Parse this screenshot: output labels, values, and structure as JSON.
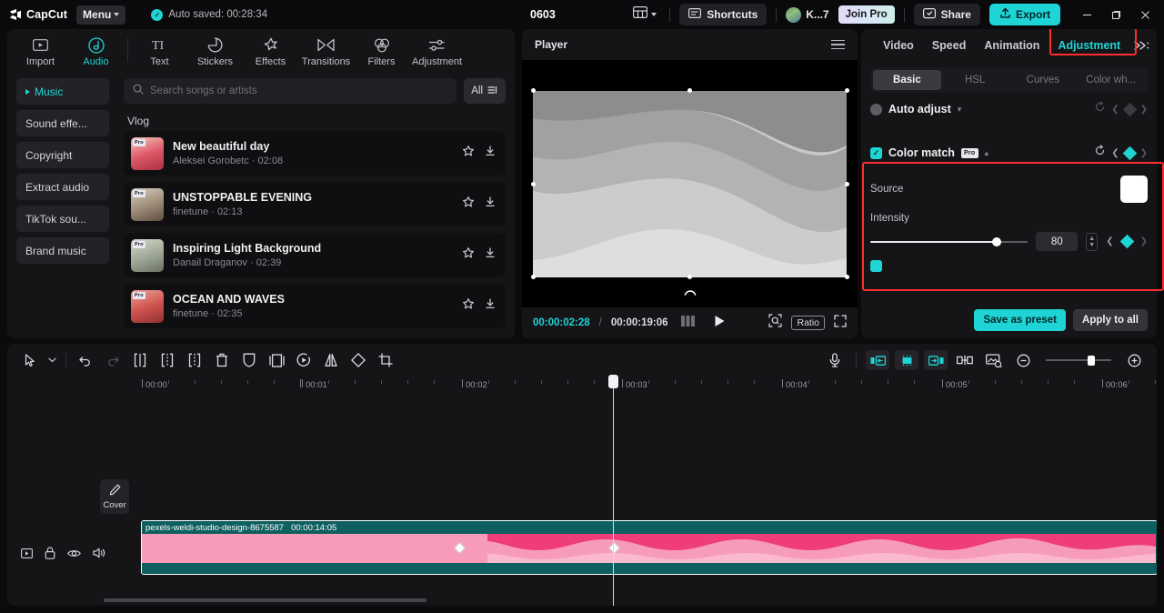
{
  "titlebar": {
    "brand": "CapCut",
    "menu_label": "Menu",
    "autosave_text": "Auto saved: 00:28:34",
    "project_name": "0603",
    "shortcuts_label": "Shortcuts",
    "user_name": "K...7",
    "join_pro_label": "Join Pro",
    "share_label": "Share",
    "export_label": "Export",
    "minimize": "–",
    "maximize": "❐",
    "close": "✕",
    "accent": "#1fd4d4"
  },
  "left_panel": {
    "tabs": [
      {
        "label": "Import",
        "icon": "import-icon"
      },
      {
        "label": "Audio",
        "icon": "audio-icon"
      },
      {
        "label": "Text",
        "icon": "text-icon"
      },
      {
        "label": "Stickers",
        "icon": "stickers-icon"
      },
      {
        "label": "Effects",
        "icon": "effects-icon"
      },
      {
        "label": "Transitions",
        "icon": "transitions-icon"
      },
      {
        "label": "Filters",
        "icon": "filters-icon"
      },
      {
        "label": "Adjustment",
        "icon": "adjustment-icon"
      }
    ],
    "active_tab": "Audio",
    "categories": [
      {
        "label": "Music",
        "active": true
      },
      {
        "label": "Sound effe...",
        "active": false
      },
      {
        "label": "Copyright",
        "active": false
      },
      {
        "label": "Extract audio",
        "active": false
      },
      {
        "label": "TikTok sou...",
        "active": false
      },
      {
        "label": "Brand music",
        "active": false
      }
    ],
    "search": {
      "placeholder": "Search songs or artists",
      "value": ""
    },
    "filter_label": "All",
    "section_title": "Vlog",
    "songs": [
      {
        "title": "New beautiful day",
        "artist": "Aleksei Gorobetc",
        "duration": "02:08",
        "badge": "Pro",
        "thumb": "t1"
      },
      {
        "title": "UNSTOPPABLE EVENING",
        "artist": "finetune",
        "duration": "02:13",
        "badge": "Pro",
        "thumb": "t2"
      },
      {
        "title": "Inspiring Light Background",
        "artist": "Danail Draganov",
        "duration": "02:39",
        "badge": "Pro",
        "thumb": "t3"
      },
      {
        "title": "OCEAN AND WAVES",
        "artist": "finetune",
        "duration": "02:35",
        "badge": "Pro",
        "thumb": "t4"
      }
    ]
  },
  "player": {
    "title": "Player",
    "current_time": "00:00:02:28",
    "separator": "/",
    "total_time": "00:00:19:06",
    "ratio_label": "Ratio"
  },
  "right_panel": {
    "tabs": [
      {
        "label": "Video",
        "active": false
      },
      {
        "label": "Speed",
        "active": false
      },
      {
        "label": "Animation",
        "active": false
      },
      {
        "label": "Adjustment",
        "active": true
      }
    ],
    "sub_tabs": [
      {
        "label": "Basic",
        "active": true
      },
      {
        "label": "HSL",
        "active": false
      },
      {
        "label": "Curves",
        "active": false
      },
      {
        "label": "Color wh...",
        "active": false
      }
    ],
    "auto_adjust": {
      "label": "Auto adjust",
      "enabled": false
    },
    "color_match": {
      "label": "Color match",
      "badge": "Pro",
      "enabled": true,
      "source_label": "Source",
      "source_color": "#ffffff",
      "intensity_label": "Intensity",
      "intensity_value": "80",
      "intensity_percent": 80
    },
    "footer": {
      "save_preset_label": "Save as preset",
      "apply_all_label": "Apply to all"
    },
    "highlight_color": "#ff2d2d"
  },
  "timeline": {
    "tools": [
      {
        "name": "select-tool-icon"
      },
      {
        "name": "select-dropdown-icon"
      },
      {
        "name": "undo-icon"
      },
      {
        "name": "redo-icon"
      },
      {
        "name": "split-icon"
      },
      {
        "name": "trim-left-icon"
      },
      {
        "name": "trim-right-icon"
      },
      {
        "name": "delete-icon"
      },
      {
        "name": "freeze-icon"
      },
      {
        "name": "crop-frame-icon"
      },
      {
        "name": "reverse-icon"
      },
      {
        "name": "mirror-icon"
      },
      {
        "name": "rotate-icon"
      },
      {
        "name": "crop-icon"
      }
    ],
    "right_tools": [
      {
        "name": "microphone-icon"
      },
      {
        "name": "snap-left-icon"
      },
      {
        "name": "auto-snap-icon"
      },
      {
        "name": "snap-right-icon"
      },
      {
        "name": "link-icon"
      },
      {
        "name": "thumbnail-icon"
      },
      {
        "name": "zoom-out-icon"
      },
      {
        "name": "zoom-in-icon"
      }
    ],
    "ruler_labels": [
      "00:00",
      "00:01",
      "00:02",
      "00:03",
      "00:04",
      "00:05",
      "00:06"
    ],
    "track_controls": [
      {
        "name": "media-icon"
      },
      {
        "name": "lock-icon"
      },
      {
        "name": "eye-icon"
      },
      {
        "name": "speaker-icon"
      }
    ],
    "cover_label": "Cover",
    "clip": {
      "name": "pexels-weldi-studio-design-8675587",
      "duration": "00:00:14:05",
      "keyframes": [
        349,
        519
      ]
    }
  }
}
